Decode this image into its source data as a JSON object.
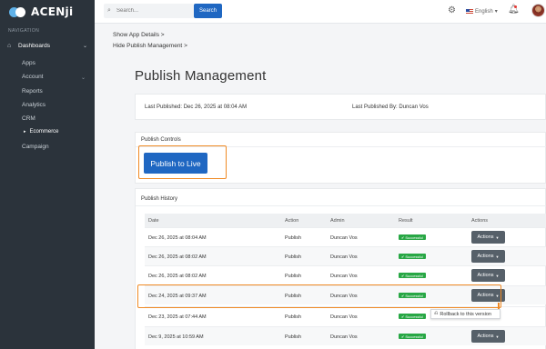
{
  "brand": {
    "name": "ACENji"
  },
  "sidebar": {
    "heading": "NAVIGATION",
    "items": [
      {
        "label": "Dashboards"
      },
      {
        "label": "Apps"
      },
      {
        "label": "Account"
      },
      {
        "label": "Reports"
      },
      {
        "label": "Analytics"
      },
      {
        "label": "CRM"
      },
      {
        "label": "Ecommerce"
      },
      {
        "label": "Campaign"
      }
    ]
  },
  "topbar": {
    "search_placeholder": "Search...",
    "search_button": "Search",
    "language": "English",
    "language_caret": "▾"
  },
  "breadcrumbs": [
    {
      "label": "Show App Details",
      "sep": ">"
    },
    {
      "label": "Hide Publish Management",
      "sep": ">"
    }
  ],
  "page": {
    "title": "Publish Management",
    "last_published_label": "Last Published:",
    "last_published_value": "Dec 26, 2025 at 08:04 AM",
    "last_published_by_label": "Last Published By:",
    "last_published_by_value": "Duncan Vos"
  },
  "publish_controls": {
    "heading": "Publish Controls",
    "button": "Publish to Live"
  },
  "history": {
    "heading": "Publish History",
    "columns": [
      "Date",
      "Action",
      "Admin",
      "Result",
      "Actions"
    ],
    "rows": [
      {
        "date": "Dec 26, 2025 at 08:04 AM",
        "action": "Publish",
        "admin": "Duncan Vos",
        "result": "Successful",
        "actions": "Actions"
      },
      {
        "date": "Dec 26, 2025 at 08:02 AM",
        "action": "Publish",
        "admin": "Duncan Vos",
        "result": "Successful",
        "actions": "Actions"
      },
      {
        "date": "Dec 26, 2025 at 08:02 AM",
        "action": "Publish",
        "admin": "Duncan Vos",
        "result": "Successful",
        "actions": "Actions"
      },
      {
        "date": "Dec 24, 2025 at 09:37 AM",
        "action": "Publish",
        "admin": "Duncan Vos",
        "result": "Successful",
        "actions": "Actions"
      },
      {
        "date": "Dec 23, 2025 at 07:44 AM",
        "action": "Publish",
        "admin": "Duncan Vos",
        "result": "Successful",
        "actions": "Actions"
      },
      {
        "date": "Dec 9, 2025 at 10:59 AM",
        "action": "Publish",
        "admin": "Duncan Vos",
        "result": "Successful",
        "actions": "Actions"
      }
    ],
    "tooltip": "Rollback to this version"
  },
  "colors": {
    "accent": "#1f67c2",
    "highlight": "#f08a24",
    "success": "#28a745",
    "sidebar": "#2b333b"
  }
}
